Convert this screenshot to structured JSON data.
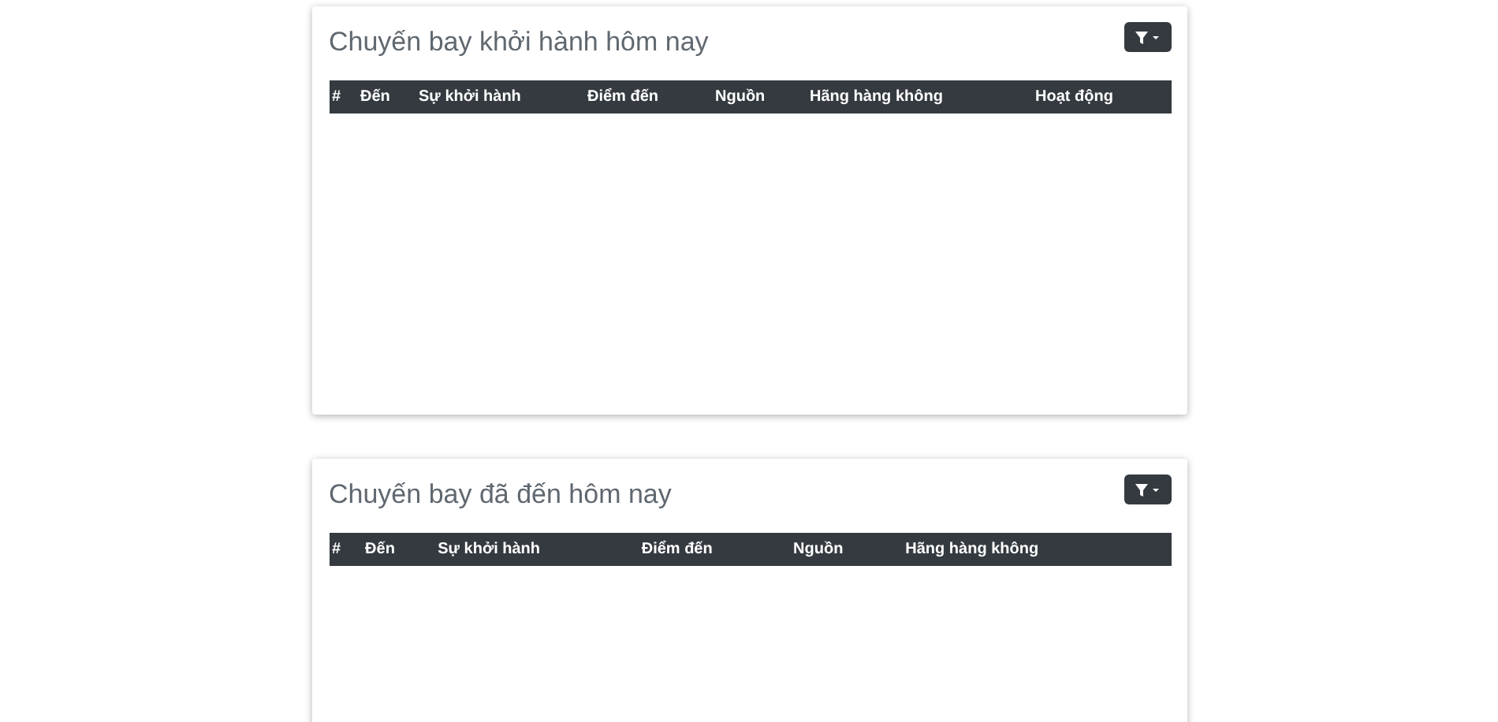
{
  "cards": [
    {
      "title": "Chuyến bay khởi hành hôm nay",
      "columns": [
        "#",
        "Đến",
        "Sự khởi hành",
        "Điểm đến",
        "Nguồn",
        "Hãng hàng không",
        "Hoạt động"
      ]
    },
    {
      "title": "Chuyến bay đã đến hôm nay",
      "columns": [
        "#",
        "Đến",
        "Sự khởi hành",
        "Điểm đến",
        "Nguồn",
        "Hãng hàng không"
      ]
    }
  ]
}
